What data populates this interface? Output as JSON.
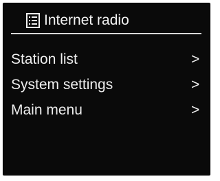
{
  "header": {
    "title": "Internet radio",
    "icon": "list-icon"
  },
  "menu": {
    "items": [
      {
        "label": "Station list",
        "arrow": ">"
      },
      {
        "label": "System settings",
        "arrow": ">"
      },
      {
        "label": "Main menu",
        "arrow": ">"
      }
    ]
  },
  "colors": {
    "screen_background": "#0a0a0a",
    "text": "#eeeeee",
    "divider": "#d9d9d9"
  }
}
